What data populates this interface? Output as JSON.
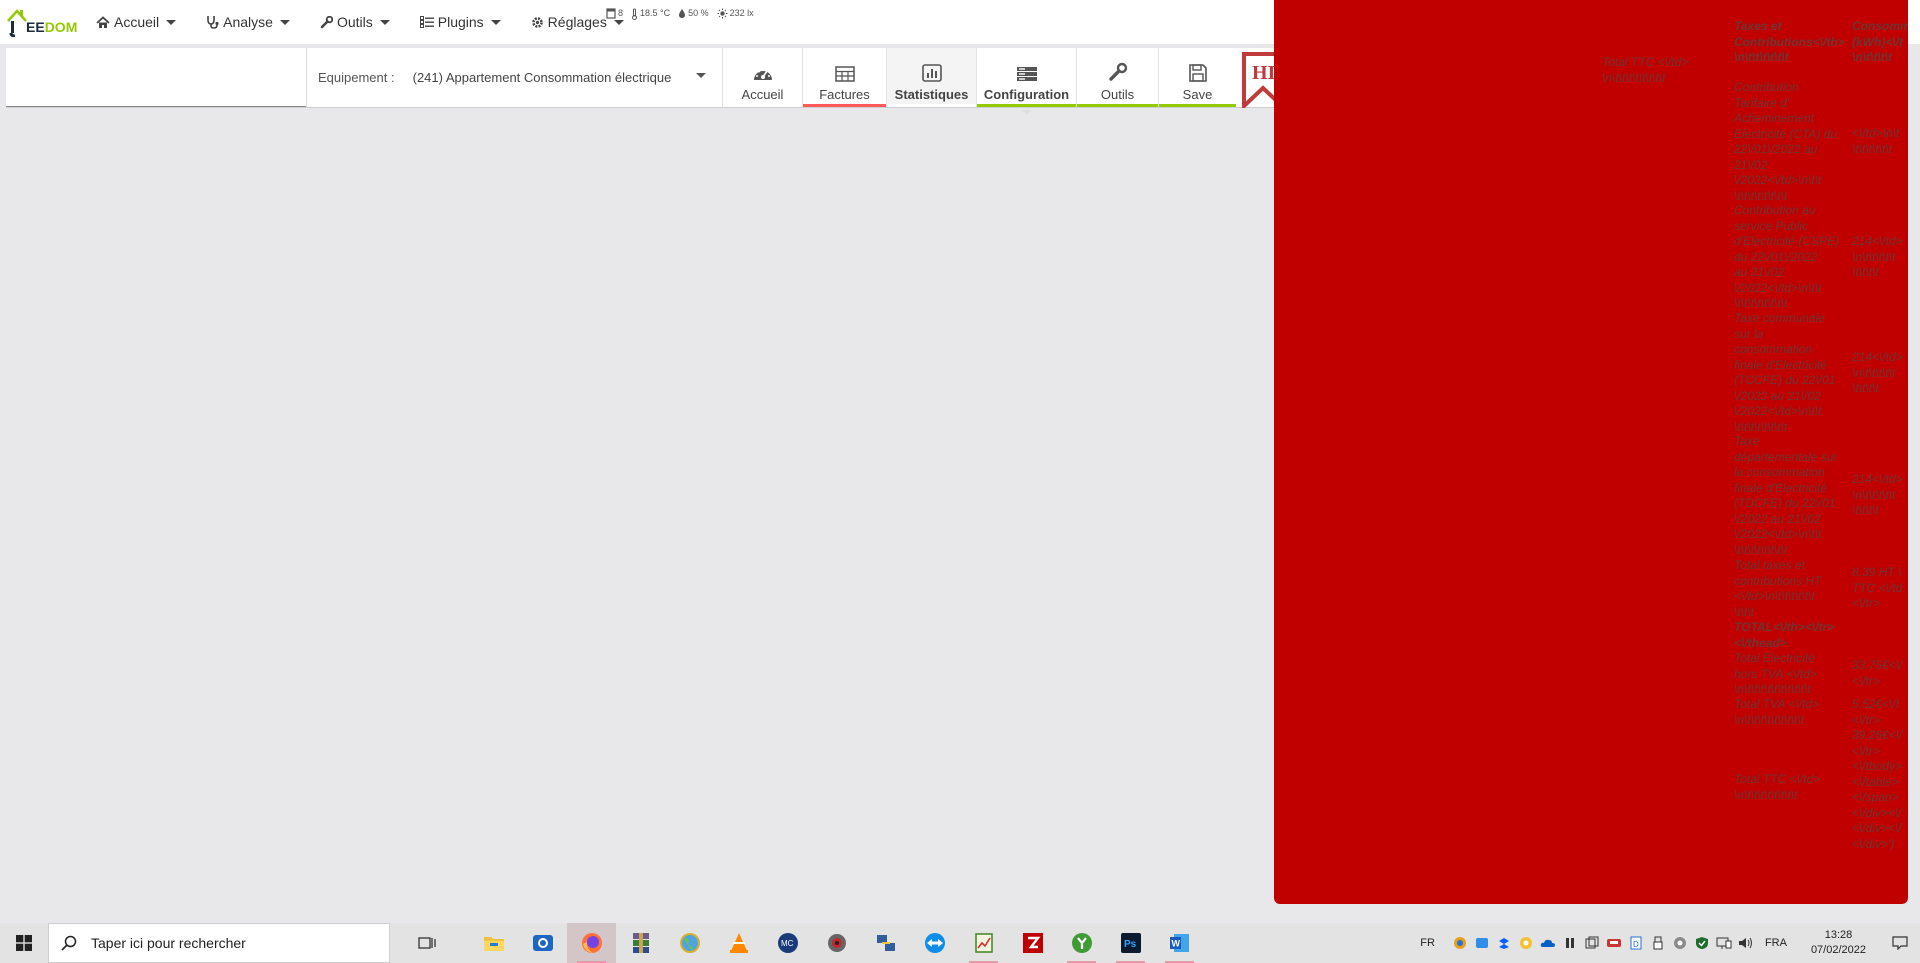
{
  "logo": {
    "text_e": "EE",
    "text_dom": "DOM"
  },
  "nav": {
    "items": [
      {
        "label": "Accueil",
        "icon": "home-icon"
      },
      {
        "label": "Analyse",
        "icon": "stethoscope-icon"
      },
      {
        "label": "Outils",
        "icon": "wrench-icon"
      },
      {
        "label": "Plugins",
        "icon": "tasks-icon"
      },
      {
        "label": "Réglages",
        "icon": "cog-icon"
      }
    ],
    "status": {
      "doors": "8",
      "temperature": "18.5 °C",
      "humidity": "50 %",
      "luminosity": "232 lx"
    }
  },
  "equipment": {
    "label": "Equipement :",
    "value": "(241) Appartement Consommation électrique"
  },
  "toolbar": {
    "accueil": "Accueil",
    "factures": "Factures",
    "statistiques": "Statistiques",
    "configuration": "Configuration",
    "outils": "Outils",
    "save": "Save",
    "ribbon_text": "HI"
  },
  "overlay": {
    "col_total_ttc_top": "Total TTC <\\/td>\n\\n\\t\\t\\t\\t\\t\\t\\t\\t",
    "header_taxes": "Taxes et\nContributions<\\/th>\n\\n\\t\\t\\t\\t\\t\\t",
    "header_conso": "Consomm\n(kWh)<\\/t\n\\n\\t\\t\\t\\t",
    "row1_label": "Contribution\nTarifaire d'\nAcheminement\nElectricité (CTA) du\n22\\/01\\/2022 au\n21\\/02\n\\/2022<\\/td>\\n\\t\\t\n\\t\\t\\t\\t\\t\\t\\t\\t",
    "row1_val": "<\\/td>\\n\\t\n\\t\\t\\t\\t\\t\\t",
    "row2_label": "Contribution au\nservice Public\nd'Electricité (CSPE)\ndu 22\\/01\\/2022\nau 21\\/02\n\\/2022<\\/td>\\n\\t\\t\n\\t\\t\\t\\t\\t\\t\\t\\t",
    "row2_val": "214<\\/td>\n\\n\\t\\t\\t\\t\\t\n\\t\\t\\t\\t",
    "row3_label": "Taxe communale\nsur la\nconsommation\nfinale d'Electricité\n(TCCFE) du 22\\/01\n\\/2022 au 21\\/02\n\\/2022<\\/td>\\n\\t\\t\n\\t\\t\\t\\t\\t\\t\\t\\t",
    "row3_val": "214<\\/td>\n\\n\\t\\t\\t\\t\\t\n\\t\\t\\t\\t",
    "row4_label": "Taxe\ndépartementale sur\nla consommation\nfinale d'Electricité\n(TDCFE) du 22\\/01\n\\/2022 au 21\\/02\n\\/2022<\\/td>\\n\\t\\t\n\\t\\t\\t\\t\\t\\t\\t\\t",
    "row4_val": "214<\\/td>\n\\n\\t\\t\\t\\t\\t\n\\t\\t\\t\\t",
    "row5_label": "Total taxes et\ncontributions HT\n<\\/td>\\n\\t\\t\\t\\t\\t\\t\n\\t\\t\\t",
    "row5_val": "8.39 HT \\\nTTC <\\/td\n<\\/tr>",
    "total_head": "TOTAL<\\/th><\\/tr>\n<\\/thead>",
    "row6_label": "Total Electricité\nhors TVA <\\/td>\n\\n\\t\\t\\t\\t\\t\\t\\t\\t\\t\\t",
    "row6_val": "33.75€<\\/\n<\\/tr>",
    "row7_label": "Total TVA <\\/td>\n\\n\\t\\t\\t\\t\\t\\t\\t\\t\\t",
    "row7_val": "5.52€<\\/t\n<\\/tr>",
    "row8_val": "39.26€<\\/\n<\\/tr>\n<\\/tbody>\n<\\/table>\n<\\/span>\n<\\/div><\\/\n<\\/div><\\/\n<\\/div>')",
    "row8_label": "Total TTC <\\/td>\n\\n\\t\\t\\t\\t\\t\\t\\t\\t"
  },
  "taskbar": {
    "search_placeholder": "Taper ici pour rechercher",
    "lang_short": "FR",
    "lang": "FRA",
    "time": "13:28",
    "date": "07/02/2022",
    "apps": [
      "task-view-icon",
      "file-explorer-icon",
      "outlook-icon",
      "firefox-icon",
      "winrar-icon",
      "globe-icon",
      "vlc-icon",
      "media-center-icon",
      "app-icon",
      "network-icon",
      "teamviewer-icon",
      "notepad-chart-icon",
      "filezilla-icon",
      "jeedom-app-icon",
      "photoshop-icon",
      "word-icon"
    ],
    "accent_underline": "#e699a8"
  },
  "colors": {
    "overlay_red": "#c00000",
    "jeedom_green": "#94ca02",
    "factures_line": "#ff5a5a",
    "config_line": "#94ca02"
  }
}
